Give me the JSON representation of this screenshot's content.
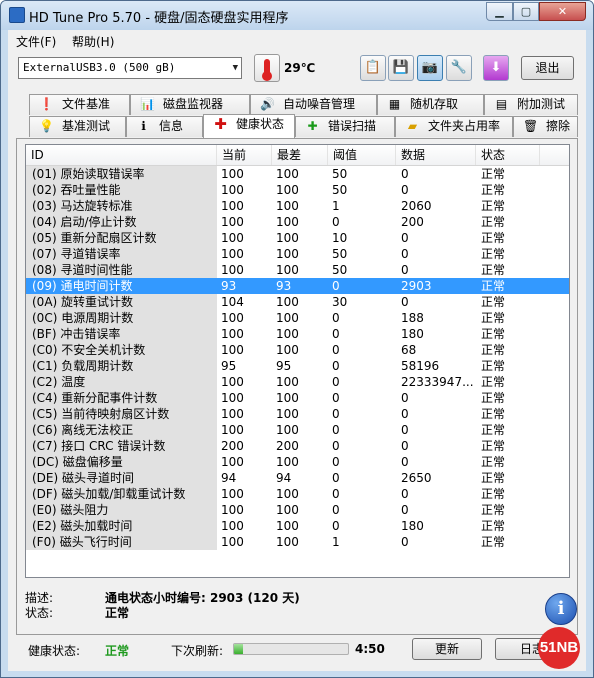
{
  "window": {
    "title": "HD Tune Pro 5.70 - 硬盘/固态硬盘实用程序"
  },
  "menu": {
    "file": "文件(F)",
    "help": "帮助(H)"
  },
  "toolbar": {
    "drive": "ExternalUSB3.0 (500 gB)",
    "temperature": "29℃",
    "exit_label": "退出",
    "icons": [
      "copy-icon",
      "save-icon",
      "camera-icon",
      "settings-icon",
      "download-icon"
    ]
  },
  "tabs_top": [
    "文件基准",
    "磁盘监视器",
    "自动噪音管理",
    "随机存取",
    "附加测试"
  ],
  "tabs_bottom": [
    "基准测试",
    "信息",
    "健康状态",
    "错误扫描",
    "文件夹占用率",
    "擦除"
  ],
  "selected_tab": "健康状态",
  "table": {
    "headers": [
      "ID",
      "当前",
      "最差",
      "阈值",
      "数据",
      "状态"
    ],
    "rows": [
      [
        "(01) 原始读取错误率",
        "100",
        "100",
        "50",
        "0",
        "正常"
      ],
      [
        "(02) 吞吐量性能",
        "100",
        "100",
        "50",
        "0",
        "正常"
      ],
      [
        "(03) 马达旋转标准",
        "100",
        "100",
        "1",
        "2060",
        "正常"
      ],
      [
        "(04) 启动/停止计数",
        "100",
        "100",
        "0",
        "200",
        "正常"
      ],
      [
        "(05) 重新分配扇区计数",
        "100",
        "100",
        "10",
        "0",
        "正常"
      ],
      [
        "(07) 寻道错误率",
        "100",
        "100",
        "50",
        "0",
        "正常"
      ],
      [
        "(08) 寻道时间性能",
        "100",
        "100",
        "50",
        "0",
        "正常"
      ],
      [
        "(09) 通电时间计数",
        "93",
        "93",
        "0",
        "2903",
        "正常"
      ],
      [
        "(0A) 旋转重试计数",
        "104",
        "100",
        "30",
        "0",
        "正常"
      ],
      [
        "(0C) 电源周期计数",
        "100",
        "100",
        "0",
        "188",
        "正常"
      ],
      [
        "(BF) 冲击错误率",
        "100",
        "100",
        "0",
        "180",
        "正常"
      ],
      [
        "(C0) 不安全关机计数",
        "100",
        "100",
        "0",
        "68",
        "正常"
      ],
      [
        "(C1) 负载周期计数",
        "95",
        "95",
        "0",
        "58196",
        "正常"
      ],
      [
        "(C2) 温度",
        "100",
        "100",
        "0",
        "22333947...",
        "正常"
      ],
      [
        "(C4) 重新分配事件计数",
        "100",
        "100",
        "0",
        "0",
        "正常"
      ],
      [
        "(C5) 当前待映射扇区计数",
        "100",
        "100",
        "0",
        "0",
        "正常"
      ],
      [
        "(C6) 离线无法校正",
        "100",
        "100",
        "0",
        "0",
        "正常"
      ],
      [
        "(C7) 接口 CRC 错误计数",
        "200",
        "200",
        "0",
        "0",
        "正常"
      ],
      [
        "(DC) 磁盘偏移量",
        "100",
        "100",
        "0",
        "0",
        "正常"
      ],
      [
        "(DE) 磁头寻道时间",
        "94",
        "94",
        "0",
        "2650",
        "正常"
      ],
      [
        "(DF) 磁头加载/卸载重试计数",
        "100",
        "100",
        "0",
        "0",
        "正常"
      ],
      [
        "(E0) 磁头阻力",
        "100",
        "100",
        "0",
        "0",
        "正常"
      ],
      [
        "(E2) 磁头加载时间",
        "100",
        "100",
        "0",
        "180",
        "正常"
      ],
      [
        "(F0) 磁头飞行时间",
        "100",
        "100",
        "1",
        "0",
        "正常"
      ]
    ],
    "selected_row": 7
  },
  "description": {
    "desc_label": "描述:",
    "desc_value": "通电状态小时编号: 2903 (120 天)",
    "status_label": "状态:",
    "status_value": "正常"
  },
  "statusbar": {
    "health_label": "健康状态:",
    "health_value": "正常",
    "refresh_label": "下次刷新:",
    "progress_fraction": 0.08,
    "countdown": "4:50",
    "update_button": "更新",
    "log_button": "日志"
  },
  "watermark": "51NB",
  "colors": {
    "selection": "#3399ff",
    "health_ok": "#1f9a1f"
  }
}
